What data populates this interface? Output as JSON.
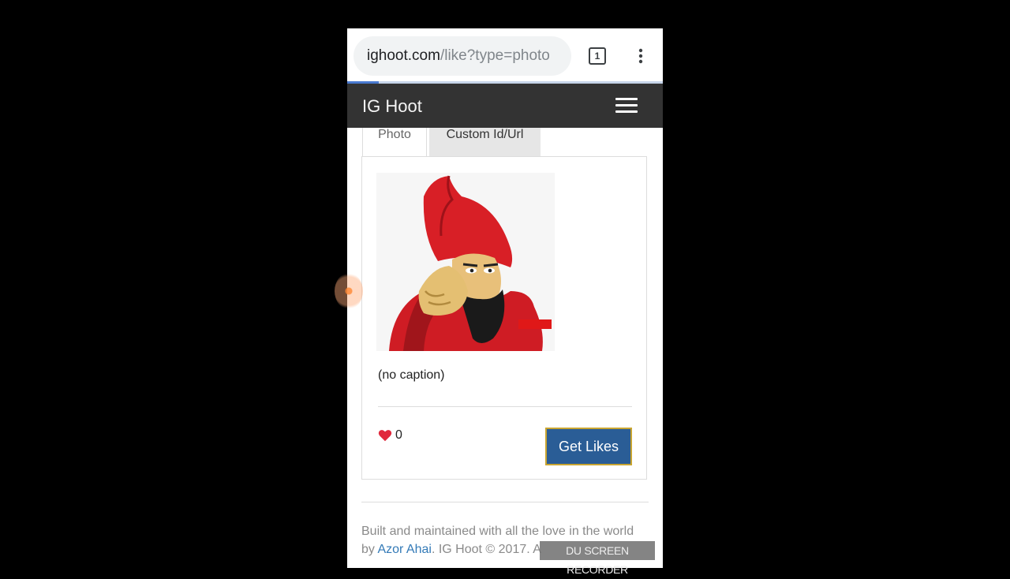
{
  "browser": {
    "url_domain": "ighoot.com",
    "url_path": "/like?type=photo",
    "tab_count": "1",
    "progress": 0.1
  },
  "navbar": {
    "brand": "IG Hoot"
  },
  "tabs": [
    {
      "label": "Photo",
      "active": true
    },
    {
      "label": "Custom Id/Url",
      "active": false
    }
  ],
  "post": {
    "caption": "(no caption)",
    "like_count": "0",
    "get_likes_label": "Get Likes"
  },
  "footer": {
    "line1": "Built and maintained with all the love in the world",
    "by": "by ",
    "author": "Azor Ahai",
    "rest": ". IG Hoot © 2017. A"
  },
  "overlay": {
    "watermark": "DU SCREEN RECORDER"
  },
  "colors": {
    "navbar_bg": "#333333",
    "button_bg": "#2a5d96",
    "link": "#337ab7",
    "heart": "#e0283c"
  }
}
